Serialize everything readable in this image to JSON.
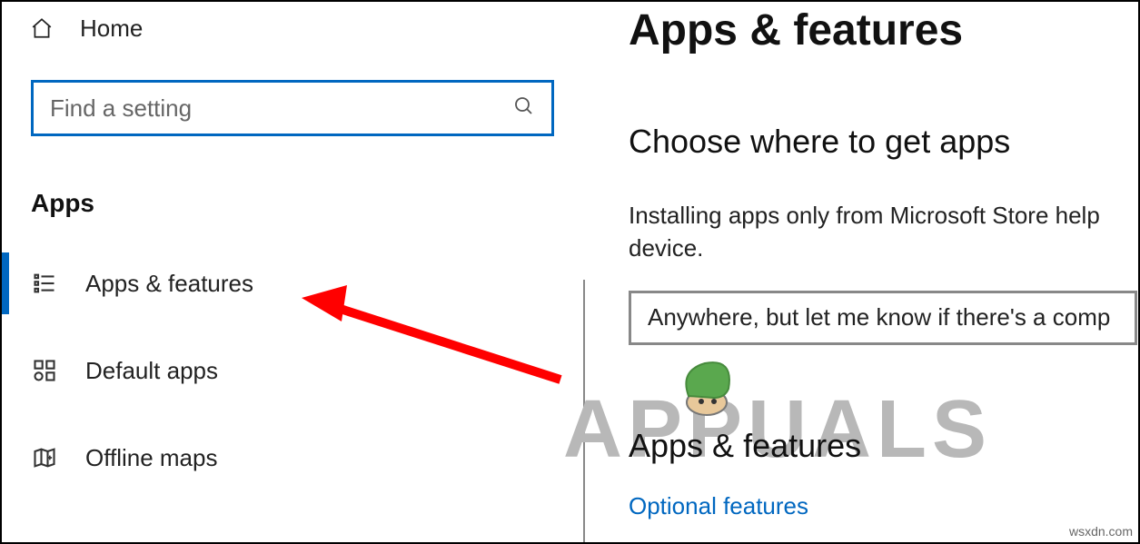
{
  "sidebar": {
    "home_label": "Home",
    "search_placeholder": "Find a setting",
    "category_title": "Apps",
    "items": [
      {
        "label": "Apps & features"
      },
      {
        "label": "Default apps"
      },
      {
        "label": "Offline maps"
      }
    ]
  },
  "main": {
    "page_title": "Apps & features",
    "subheading": "Choose where to get apps",
    "description_line1": "Installing apps only from Microsoft Store help",
    "description_line2": "device.",
    "dropdown_value": "Anywhere, but let me know if there's a comp",
    "section2_title": "Apps & features",
    "optional_link": "Optional features"
  },
  "watermark": {
    "text": "APPUALS",
    "attribution": "wsxdn.com"
  }
}
